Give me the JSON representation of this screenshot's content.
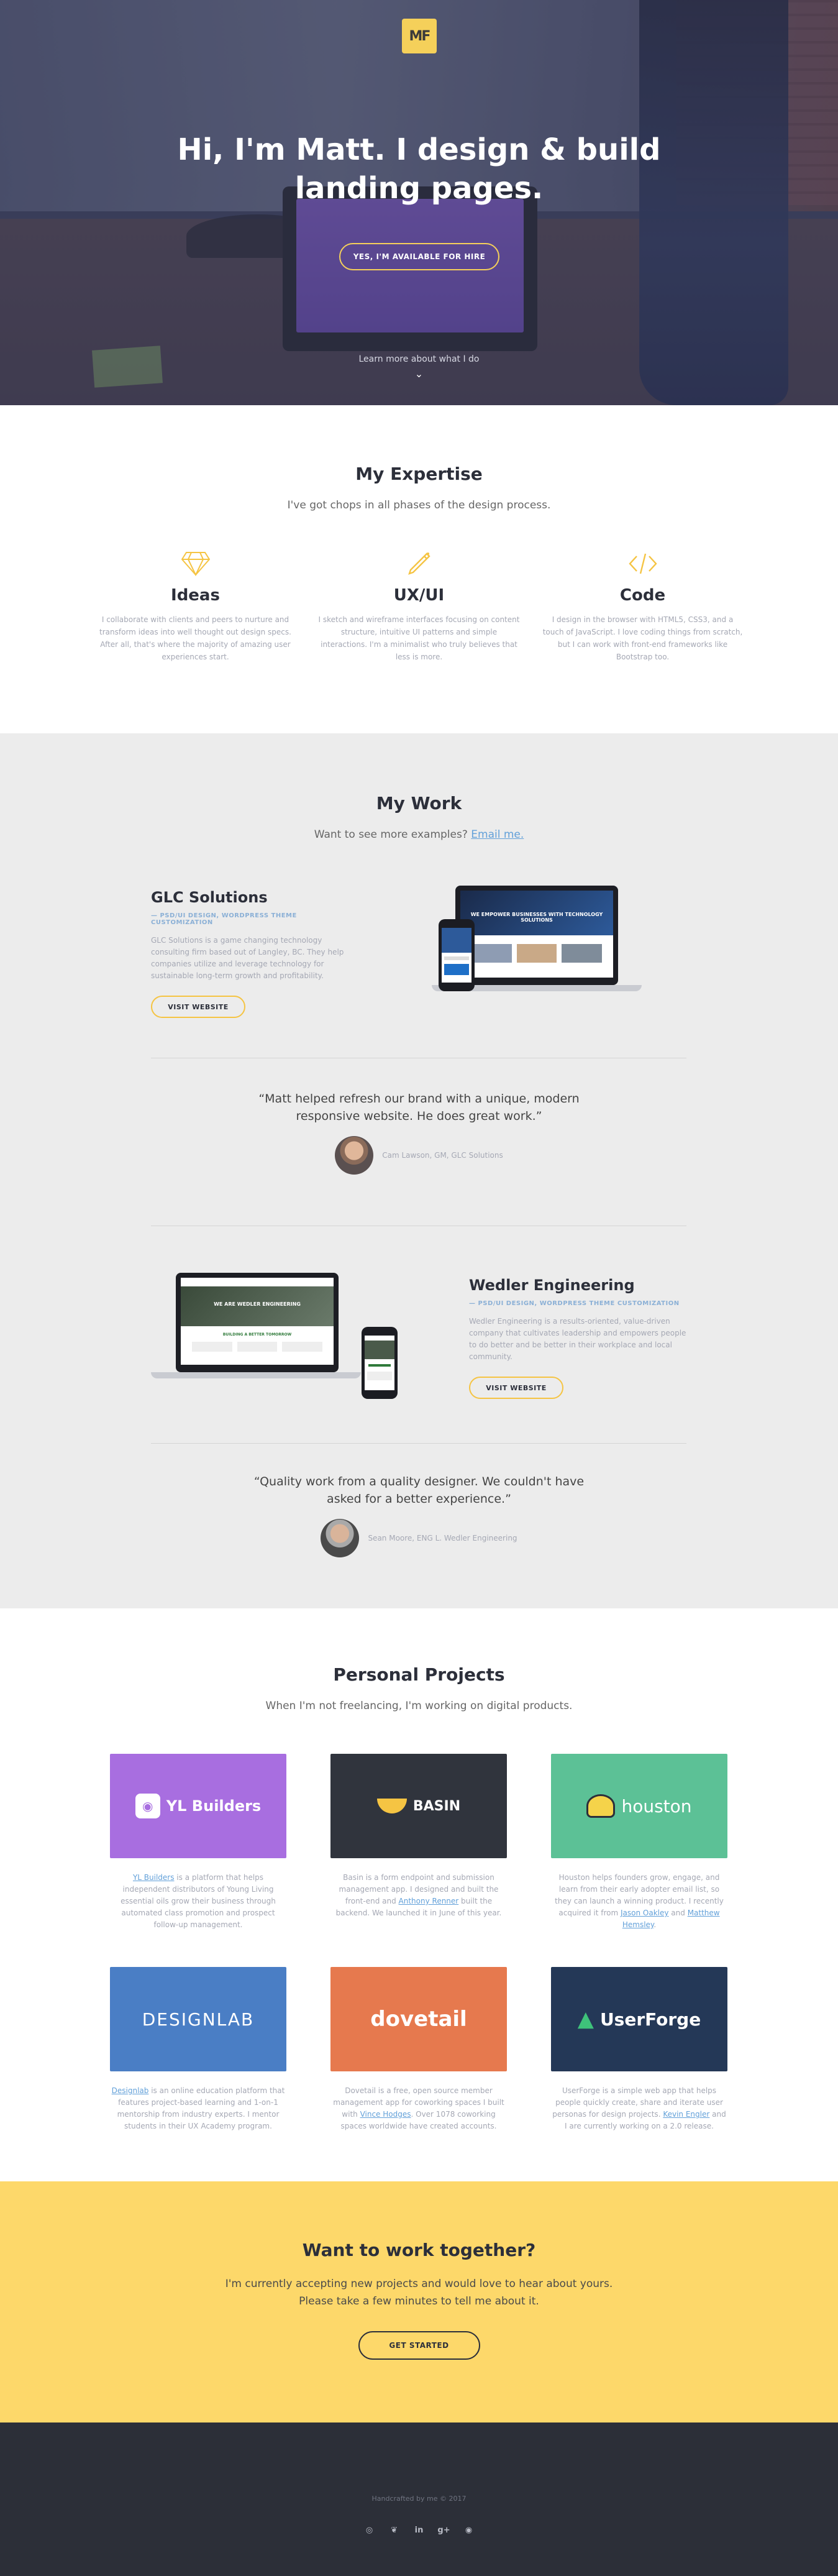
{
  "hero": {
    "logo_text": "MF",
    "headline_line1": "Hi, I'm Matt. I design & build",
    "headline_line2": "landing pages.",
    "cta_label": "YES, I'M AVAILABLE FOR HIRE",
    "more_label": "Learn more about what I do"
  },
  "expertise": {
    "title": "My Expertise",
    "subtitle": "I've got chops in all phases of the design process.",
    "items": [
      {
        "icon": "diamond-icon",
        "title": "Ideas",
        "text": "I collaborate with clients and peers to nurture and transform ideas into well thought out design specs. After all, that's where the majority of amazing user experiences start."
      },
      {
        "icon": "pen-icon",
        "title": "UX/UI",
        "text": "I sketch and wireframe interfaces focusing on content structure, intuitive UI patterns and simple interactions. I'm a minimalist who truly believes that less is more."
      },
      {
        "icon": "code-icon",
        "title": "Code",
        "text": "I design in the browser with HTML5, CSS3, and a touch of JavaScript. I love coding things from scratch, but I can work with front-end frameworks like Bootstrap too."
      }
    ]
  },
  "work": {
    "title": "My Work",
    "subtitle": "Want to see more examples?",
    "subtitle_link": "Email me.",
    "projects": [
      {
        "name": "GLC Solutions",
        "tags": "— PSD/UI DESIGN, WORDPRESS THEME CUSTOMIZATION",
        "text": "GLC Solutions is a game changing technology consulting firm based out of Langley, BC. They help companies utilize and leverage technology for sustainable long-term growth and profitability.",
        "button": "VISIT WEBSITE",
        "screen_title": "WE EMPOWER BUSINESSES WITH TECHNOLOGY SOLUTIONS"
      },
      {
        "name": "Wedler Engineering",
        "tags": "— PSD/UI DESIGN, WORDPRESS THEME CUSTOMIZATION",
        "text": "Wedler Engineering is a results-oriented, value-driven company that cultivates leadership and empowers people to do better and be better in their workplace and local community.",
        "button": "VISIT WEBSITE",
        "screen_title": "WE ARE WEDLER ENGINEERING",
        "screen_sub": "BUILDING A BETTER TOMORROW"
      }
    ],
    "testimonials": [
      {
        "line1": "“Matt helped refresh our brand with a unique, modern",
        "line2": "responsive website. He does great work.”",
        "name": "Cam Lawson, GM, GLC Solutions"
      },
      {
        "line1": "“Quality work from a quality designer. We couldn't have",
        "line2": "asked for a better experience.”",
        "name": "Sean Moore, ENG L. Wedler Engineering"
      }
    ]
  },
  "personal": {
    "title": "Personal Projects",
    "subtitle": "When I'm not freelancing, I'm working on digital products.",
    "cards": [
      {
        "brand": "YL Builders",
        "color": "#a86ee0",
        "link": "YL Builders",
        "text": " is a platform that helps independent distributors of Young Living essential oils grow their business through automated class promotion and prospect follow-up management."
      },
      {
        "brand": "BASIN",
        "color": "#30343d",
        "text_a": "Basin is a form endpoint and submission management app. I designed and built the front-end and ",
        "link": "Anthony Renner",
        "text_b": " built the backend. We launched it in June of this year."
      },
      {
        "brand": "houston",
        "color": "#5cc196",
        "text_a": "Houston helps founders grow, engage, and learn from their early adopter email list, so they can launch a winning product. I recently acquired it from ",
        "link": "Jason Oakley",
        "text_mid": " and ",
        "link2": "Matthew Hemsley",
        "text_b": "."
      },
      {
        "brand": "DESIGNLAB",
        "color": "#4a7ec5",
        "link": "Designlab",
        "text": " is an online education platform that features project-based learning and 1-on-1 mentorship from industry experts. I mentor students in their UX Academy program."
      },
      {
        "brand": "dovetail",
        "color": "#e6794e",
        "text_a": "Dovetail is a free, open source member management app for coworking spaces I built with ",
        "link": "Vince Hodges",
        "text_b": ". Over 1078 coworking spaces worldwide have created accounts."
      },
      {
        "brand": "UserForge",
        "color": "#243857",
        "text_a": "UserForge is a simple web app that helps people quickly create, share and iterate user personas for design projects. ",
        "link": "Kevin Engler",
        "text_b": " and I are currently working on a 2.0 release."
      }
    ]
  },
  "cta": {
    "title": "Want to work together?",
    "line1": "I'm currently accepting new projects and would love to hear about yours.",
    "line2": "Please take a few minutes to tell me about it.",
    "button": "GET STARTED"
  },
  "footer": {
    "made": "Handcrafted by me © 2017",
    "socials": [
      "dribbble-icon",
      "twitter-icon",
      "linkedin-icon",
      "googleplus-icon",
      "github-icon"
    ]
  },
  "colors": {
    "accent": "#f5c443",
    "yellow_bg": "#fdd86a",
    "dark": "#2c2f38",
    "link": "#62a0d9"
  }
}
